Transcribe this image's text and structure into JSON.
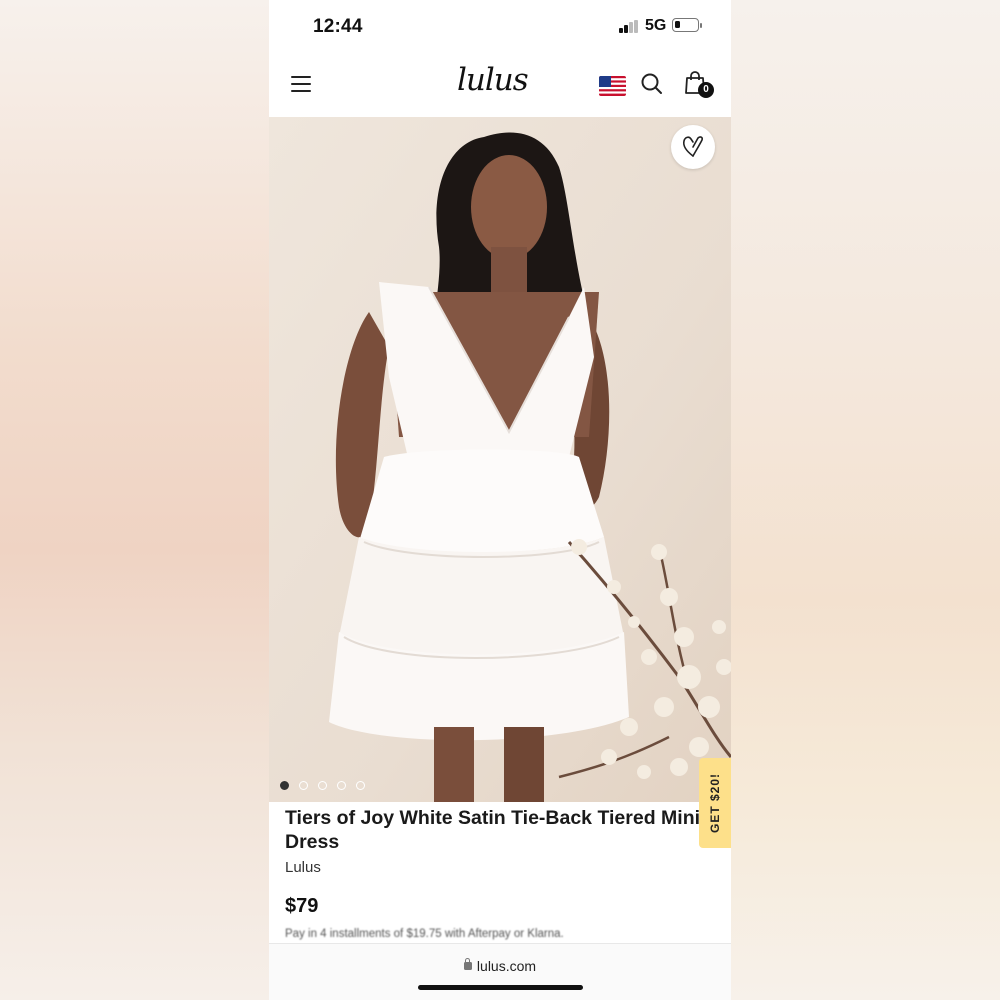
{
  "status_bar": {
    "time": "12:44",
    "network": "5G",
    "battery_level": 0.22
  },
  "header": {
    "logo": "lulus",
    "cart_count": "0",
    "icons": [
      "menu-icon",
      "flag-icon",
      "search-icon",
      "bag-icon"
    ]
  },
  "hero": {
    "image_count": 5,
    "active_image": 1,
    "wishlist_icon": "heart-icon"
  },
  "promo": {
    "label": "GET $20!"
  },
  "product": {
    "title": "Tiers of Joy White Satin Tie-Back Tiered Mini Dress",
    "brand": "Lulus",
    "price": "$79",
    "installments": "Pay in 4 installments of $19.75 with Afterpay or Klarna."
  },
  "browser": {
    "url": "lulus.com"
  },
  "colors": {
    "promo_bg": "#fde08a",
    "text": "#1a1a1a",
    "page_bg": "#ffffff"
  }
}
